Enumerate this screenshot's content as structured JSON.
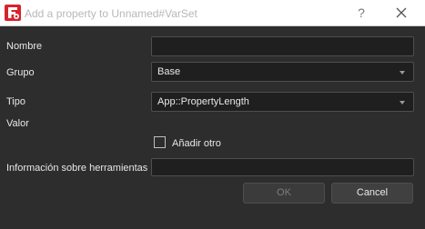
{
  "window": {
    "title": "Add a property to Unnamed#VarSet",
    "help_label": "?"
  },
  "form": {
    "name_label": "Nombre",
    "name_value": "",
    "group_label": "Grupo",
    "group_value": "Base",
    "type_label": "Tipo",
    "type_value": "App::PropertyLength",
    "value_label": "Valor",
    "add_another_label": "Añadir otro",
    "add_another_checked": false,
    "tooltip_label": "Información sobre herramientas",
    "tooltip_value": ""
  },
  "buttons": {
    "ok_label": "OK",
    "cancel_label": "Cancel"
  },
  "colors": {
    "background": "#2d2d2d",
    "field_background": "#1f1f1f",
    "app_icon_red": "#d8232a"
  }
}
